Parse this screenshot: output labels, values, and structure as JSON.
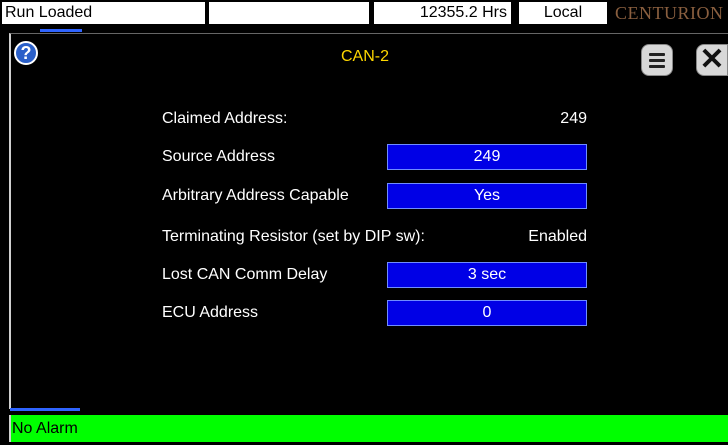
{
  "status_bar": {
    "run_state": "Run Loaded",
    "hours": "12355.2 Hrs",
    "mode": "Local",
    "brand": "CENTURION"
  },
  "dialog": {
    "title": "CAN-2",
    "help_icon": "question-icon",
    "menu_icon": "menu-icon",
    "close_icon": "close-icon",
    "rows": [
      {
        "label": "Claimed Address:",
        "value": "249",
        "editable": false
      },
      {
        "label": "Source Address",
        "value": "249",
        "editable": true
      },
      {
        "label": "Arbitrary Address Capable",
        "value": "Yes",
        "editable": true
      },
      {
        "label": "Terminating Resistor (set by DIP sw):",
        "value": "Enabled",
        "editable": false
      },
      {
        "label": "Lost CAN Comm Delay",
        "value": "3 sec",
        "editable": true
      },
      {
        "label": "ECU Address",
        "value": "0",
        "editable": true
      }
    ]
  },
  "alarm_bar": {
    "text": "No Alarm",
    "color": "#00ff00"
  },
  "colors": {
    "field_bg": "#0000e6",
    "title": "#ffd700",
    "accent": "#2f64ff"
  }
}
